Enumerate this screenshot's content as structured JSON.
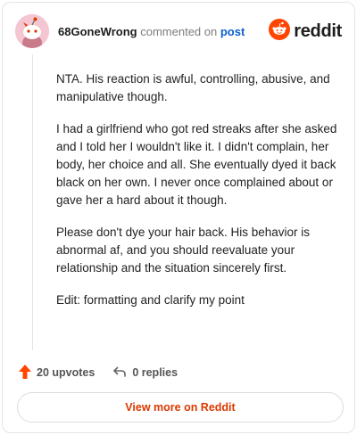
{
  "header": {
    "username": "68GoneWrong",
    "action_text": "commented on",
    "post_link": "post",
    "brand": "reddit",
    "avatar_icon": "snoo-avatar-icon",
    "brand_icon": "reddit-logo-icon",
    "brand_color": "#ff4500"
  },
  "comment": {
    "paragraphs": [
      "NTA. His reaction is awful, controlling, abusive, and manipulative though.",
      "I had a girlfriend who got red streaks after she asked and I told her I wouldn't like it. I didn't complain, her body, her choice and all. She eventually dyed it back black on her own. I never once complained about or gave her a hard about it though.",
      "Please don't dye your hair back. His behavior is abnormal af, and you should reevaluate your relationship and the situation sincerely first.",
      "Edit: formatting and clarify my point"
    ]
  },
  "actions": {
    "upvotes": "20 upvotes",
    "replies": "0 replies",
    "upvote_icon": "upvote-arrow-icon",
    "reply_icon": "reply-arrow-icon",
    "upvote_color": "#ff4500"
  },
  "footer": {
    "view_more": "View more on Reddit",
    "accent": "#d93a00"
  }
}
